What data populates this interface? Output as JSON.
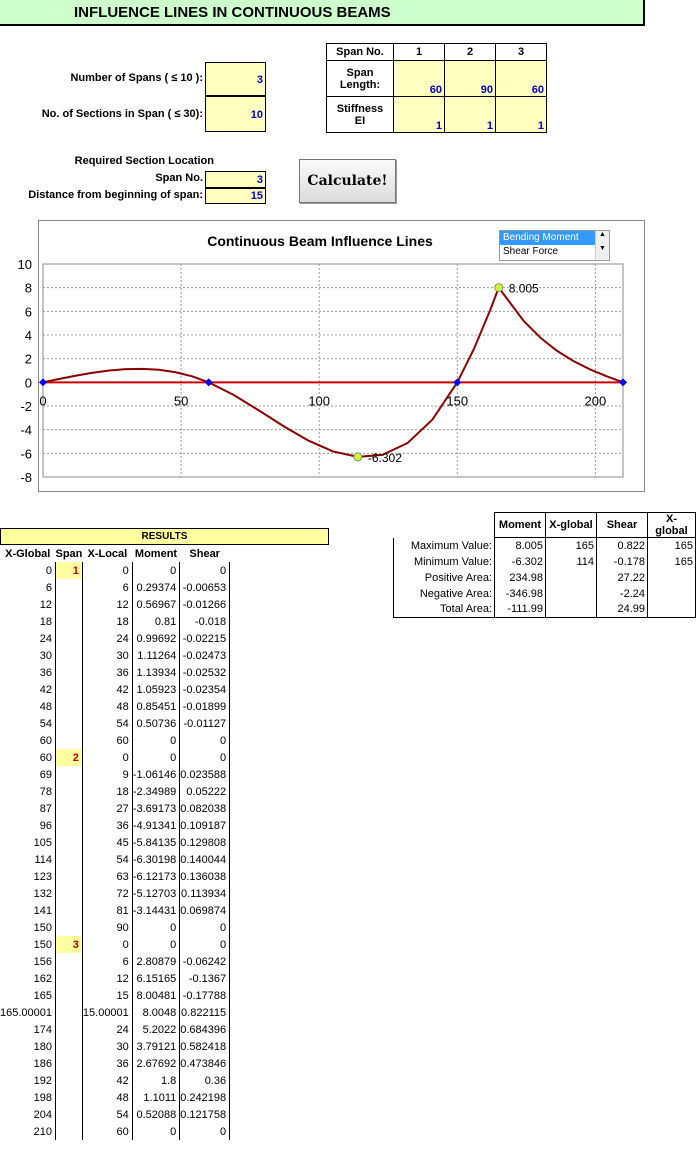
{
  "title": "INFLUENCE LINES IN CONTINUOUS BEAMS",
  "inputs": {
    "num_spans_label": "Number of Spans ( ≤ 10 ):",
    "num_spans": "3",
    "num_sections_label": "No. of Sections in Span ( ≤ 30):",
    "num_sections": "10",
    "required_label": "Required Section Location",
    "span_no_label": "Span No.",
    "span_no": "3",
    "distance_label": "Distance from beginning of span:",
    "distance": "15"
  },
  "span_table": {
    "h_span_no": "Span No.",
    "h_span": "Span",
    "h_length": "Length:",
    "h_stiff": "Stiffness",
    "h_ei": "EI",
    "spans": [
      "1",
      "2",
      "3"
    ],
    "lengths": [
      "60",
      "90",
      "60"
    ],
    "ei": [
      "1",
      "1",
      "1"
    ]
  },
  "calculate_label": "Calculate!",
  "listbox": {
    "options": [
      "Bending Moment",
      "Shear Force"
    ],
    "selected": "Bending Moment"
  },
  "chart_data": {
    "type": "line",
    "title": "Continuous Beam Influence Lines",
    "xlabel": "",
    "ylabel": "",
    "xlim": [
      0,
      210
    ],
    "ylim": [
      -8,
      10
    ],
    "xticks": [
      0,
      50,
      100,
      150,
      200
    ],
    "yticks": [
      10,
      8,
      6,
      4,
      2,
      0,
      -2,
      -4,
      -6,
      -8
    ],
    "grid": true,
    "series": [
      {
        "x": [
          0,
          6,
          12,
          18,
          24,
          30,
          36,
          42,
          48,
          54,
          60,
          69,
          78,
          87,
          96,
          105,
          114,
          123,
          132,
          141,
          150,
          156,
          162,
          165.00001,
          174,
          180,
          186,
          192,
          198,
          204,
          210
        ],
        "y": [
          0,
          0.29374,
          0.56967,
          0.81,
          0.99692,
          1.11264,
          1.13934,
          1.05923,
          0.85451,
          0.50736,
          0,
          -1.06146,
          -2.34989,
          -3.69173,
          -4.91341,
          -5.84135,
          -6.30198,
          -6.12173,
          -5.12703,
          -3.14431,
          0,
          2.80879,
          6.15165,
          8.0048,
          5.2022,
          3.79121,
          2.67692,
          1.8,
          1.1011,
          0.52088,
          0
        ],
        "color": "#8b0000"
      }
    ],
    "supports": [
      0,
      60,
      150,
      210
    ],
    "annotations": [
      {
        "x": 165,
        "y": 8.005,
        "text": "8.005"
      },
      {
        "x": 114,
        "y": -6.302,
        "text": "-6.302"
      }
    ]
  },
  "results": {
    "header": "RESULTS",
    "columns": [
      "X-Global",
      "Span",
      "X-Local",
      "Moment",
      "Shear"
    ],
    "rows": [
      [
        "0",
        "1",
        "0",
        "0",
        "0"
      ],
      [
        "6",
        "",
        "6",
        "0.29374",
        "-0.00653"
      ],
      [
        "12",
        "",
        "12",
        "0.56967",
        "-0.01266"
      ],
      [
        "18",
        "",
        "18",
        "0.81",
        "-0.018"
      ],
      [
        "24",
        "",
        "24",
        "0.99692",
        "-0.02215"
      ],
      [
        "30",
        "",
        "30",
        "1.11264",
        "-0.02473"
      ],
      [
        "36",
        "",
        "36",
        "1.13934",
        "-0.02532"
      ],
      [
        "42",
        "",
        "42",
        "1.05923",
        "-0.02354"
      ],
      [
        "48",
        "",
        "48",
        "0.85451",
        "-0.01899"
      ],
      [
        "54",
        "",
        "54",
        "0.50736",
        "-0.01127"
      ],
      [
        "60",
        "",
        "60",
        "0",
        "0"
      ],
      [
        "60",
        "2",
        "0",
        "0",
        "0"
      ],
      [
        "69",
        "",
        "9",
        "-1.06146",
        "0.023588"
      ],
      [
        "78",
        "",
        "18",
        "-2.34989",
        "0.05222"
      ],
      [
        "87",
        "",
        "27",
        "-3.69173",
        "0.082038"
      ],
      [
        "96",
        "",
        "36",
        "-4.91341",
        "0.109187"
      ],
      [
        "105",
        "",
        "45",
        "-5.84135",
        "0.129808"
      ],
      [
        "114",
        "",
        "54",
        "-6.30198",
        "0.140044"
      ],
      [
        "123",
        "",
        "63",
        "-6.12173",
        "0.136038"
      ],
      [
        "132",
        "",
        "72",
        "-5.12703",
        "0.113934"
      ],
      [
        "141",
        "",
        "81",
        "-3.14431",
        "0.069874"
      ],
      [
        "150",
        "",
        "90",
        "0",
        "0"
      ],
      [
        "150",
        "3",
        "0",
        "0",
        "0"
      ],
      [
        "156",
        "",
        "6",
        "2.80879",
        "-0.06242"
      ],
      [
        "162",
        "",
        "12",
        "6.15165",
        "-0.1367"
      ],
      [
        "165",
        "",
        "15",
        "8.00481",
        "-0.17788"
      ],
      [
        "165.00001",
        "",
        "15.00001",
        "8.0048",
        "0.822115"
      ],
      [
        "174",
        "",
        "24",
        "5.2022",
        "0.684396"
      ],
      [
        "180",
        "",
        "30",
        "3.79121",
        "0.582418"
      ],
      [
        "186",
        "",
        "36",
        "2.67692",
        "0.473846"
      ],
      [
        "192",
        "",
        "42",
        "1.8",
        "0.36"
      ],
      [
        "198",
        "",
        "48",
        "1.1011",
        "0.242198"
      ],
      [
        "204",
        "",
        "54",
        "0.52088",
        "0.121758"
      ],
      [
        "210",
        "",
        "60",
        "0",
        "0"
      ]
    ]
  },
  "summary": {
    "columns": [
      "",
      "Moment",
      "X-global",
      "Shear",
      "X-global"
    ],
    "rows": [
      [
        "Maximum Value:",
        "8.005",
        "165",
        "0.822",
        "165"
      ],
      [
        "Minimum Value:",
        "-6.302",
        "114",
        "-0.178",
        "165"
      ],
      [
        "Positive Area:",
        "234.98",
        "",
        "27.22",
        ""
      ],
      [
        "Negative Area:",
        "-346.98",
        "",
        "-2.24",
        ""
      ],
      [
        "Total Area:",
        "-111.99",
        "",
        "24.99",
        ""
      ]
    ]
  }
}
